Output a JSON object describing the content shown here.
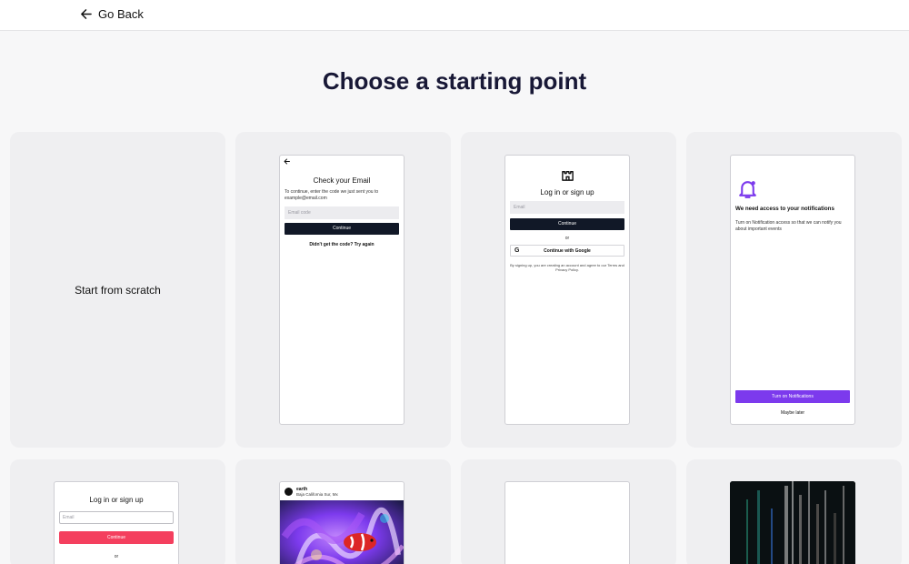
{
  "header": {
    "back_label": "Go Back"
  },
  "page_title": "Choose a starting point",
  "templates": {
    "scratch": {
      "label": "Start from scratch"
    },
    "email_code": {
      "title": "Check your Email",
      "description": "To continue, enter the code we just sent you to example@email.com",
      "input_placeholder": "Email code",
      "button": "Continue",
      "link": "Didn't get the code? Try again"
    },
    "login_google": {
      "title": "Log in or sign up",
      "input_placeholder": "Email",
      "button": "Continue",
      "or": "or",
      "google_button": "Continue with Google",
      "terms": "By signing up, you are creating an account and agree to our Terms and Privacy Policy."
    },
    "notifications": {
      "title": "We need access to your notifications",
      "description": "Turn on Notification access so that we can notify you about important events",
      "button": "Turn on Notifications",
      "secondary": "Maybe later",
      "accent": "#7c3aed"
    },
    "login_pink": {
      "title": "Log in or sign up",
      "input_placeholder": "Email",
      "button": "Continue",
      "or": "or",
      "accent": "#f43f5e"
    },
    "social_post": {
      "username": "earth",
      "location": "Baja California Sur, Mx"
    }
  }
}
